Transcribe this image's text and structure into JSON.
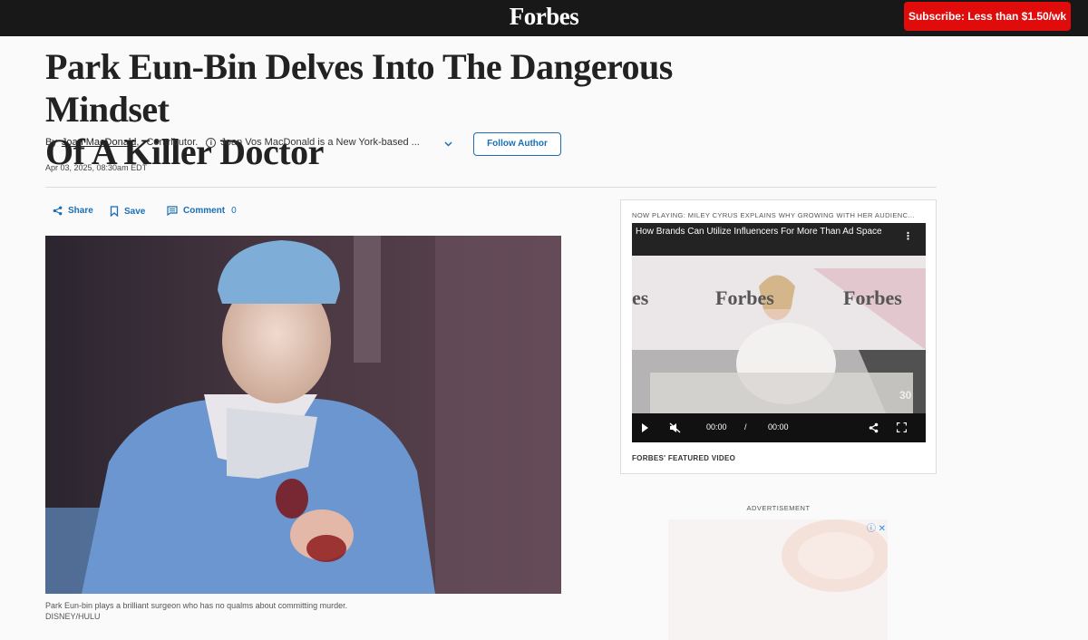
{
  "header": {
    "logo": "Forbes",
    "subscribe_label": "Subscribe: Less than $1.50/wk"
  },
  "article": {
    "title_line1": "Park Eun-Bin Delves Into The Dangerous Mindset",
    "title_line2": "Of A Killer Doctor",
    "by_label": "By",
    "author": "Joan MacDonald",
    "comma": ",",
    "role": "Contributor.",
    "bio": "Joan Vos MacDonald is a New York-based ...",
    "follow_label": "Follow Author",
    "date": "Apr 03, 2025, 08:30am EDT",
    "actions": {
      "share": "Share",
      "save": "Save",
      "comment": "Comment",
      "comment_count": "0"
    },
    "caption": "Park Eun-bin plays a brilliant surgeon who has no qualms about committing murder.",
    "credit": "DISNEY/HULU"
  },
  "video": {
    "now_playing": "NOW PLAYING: MILEY CYRUS EXPLAINS WHY GROWING WITH HER AUDIENC...",
    "title": "How Brands Can Utilize Influencers For More Than Ad Space",
    "current_time": "00:00",
    "separator": "/",
    "duration": "00:00",
    "featured_label": "FORBES' FEATURED VIDEO",
    "backdrop_text": "Forbes",
    "backdrop_left": "es",
    "backdrop_number": "30"
  },
  "ad": {
    "label": "ADVERTISEMENT"
  },
  "colors": {
    "topbar": "#181818",
    "subscribe": "#e00c0c",
    "link": "#1a6eb5"
  },
  "icons": [
    "share-icon",
    "bookmark-icon",
    "comment-icon",
    "info-icon",
    "chevron-down-icon",
    "play-icon",
    "mute-icon",
    "fullscreen-icon",
    "more-icon",
    "ad-info-icon",
    "close-icon"
  ]
}
